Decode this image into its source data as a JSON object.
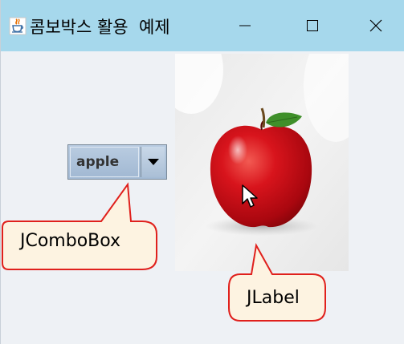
{
  "window": {
    "title": "콤보박스 활용  예제",
    "controls": {
      "minimize": "minimize-icon",
      "maximize": "maximize-icon",
      "close": "close-icon"
    }
  },
  "combobox": {
    "selected": "apple"
  },
  "image_label": {
    "subject": "red apple photo"
  },
  "callouts": {
    "combobox": "JComboBox",
    "label": "JLabel"
  },
  "colors": {
    "titlebar": "#a6d8ec",
    "callout_border": "#e0201c",
    "callout_fill": "#fdf3e1",
    "combo": "#a8bdd6"
  }
}
